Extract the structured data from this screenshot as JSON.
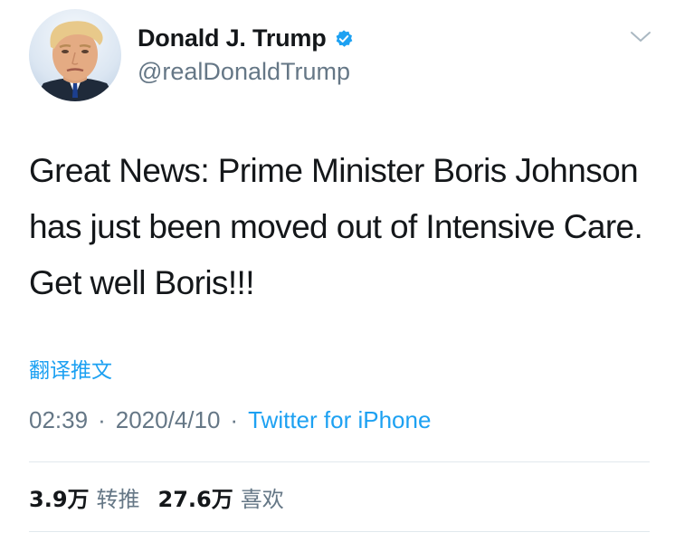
{
  "author": {
    "display_name": "Donald J. Trump",
    "handle": "@realDonaldTrump",
    "verified": true
  },
  "tweet": {
    "text": "Great News: Prime Minister Boris Johnson has just been moved out of Intensive Care. Get well Boris!!!",
    "translate_label": "翻译推文",
    "time": "02:39",
    "separator": "·",
    "date": "2020/4/10",
    "source": "Twitter for iPhone"
  },
  "stats": {
    "retweets_count": "3.9万",
    "retweets_label": "转推",
    "likes_count": "27.6万",
    "likes_label": "喜欢"
  },
  "icons": {
    "verified": "verified-badge-icon",
    "menu": "chevron-down-icon"
  },
  "colors": {
    "link": "#1da1f2",
    "secondary_text": "#657786",
    "primary_text": "#14171a",
    "divider": "#e1e8ed"
  }
}
